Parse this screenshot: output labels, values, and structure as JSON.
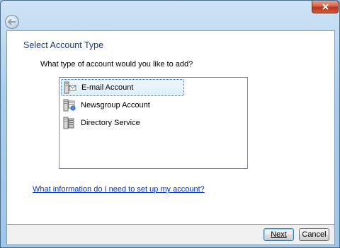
{
  "dialog": {
    "page_title": "Select Account Type",
    "question": "What type of account would you like to add?",
    "help_link": "What information do I need to set up my account?"
  },
  "accounts": [
    {
      "label": "E-mail Account",
      "icon": "email-account-icon",
      "selected": true
    },
    {
      "label": "Newsgroup Account",
      "icon": "newsgroup-account-icon",
      "selected": false
    },
    {
      "label": "Directory Service",
      "icon": "directory-service-icon",
      "selected": false
    }
  ],
  "buttons": {
    "next_label": "Next",
    "cancel_label": "Cancel"
  },
  "colors": {
    "title_blue": "#1e3a87",
    "link_blue": "#0033cc",
    "selection_border": "#3d6fa8"
  }
}
